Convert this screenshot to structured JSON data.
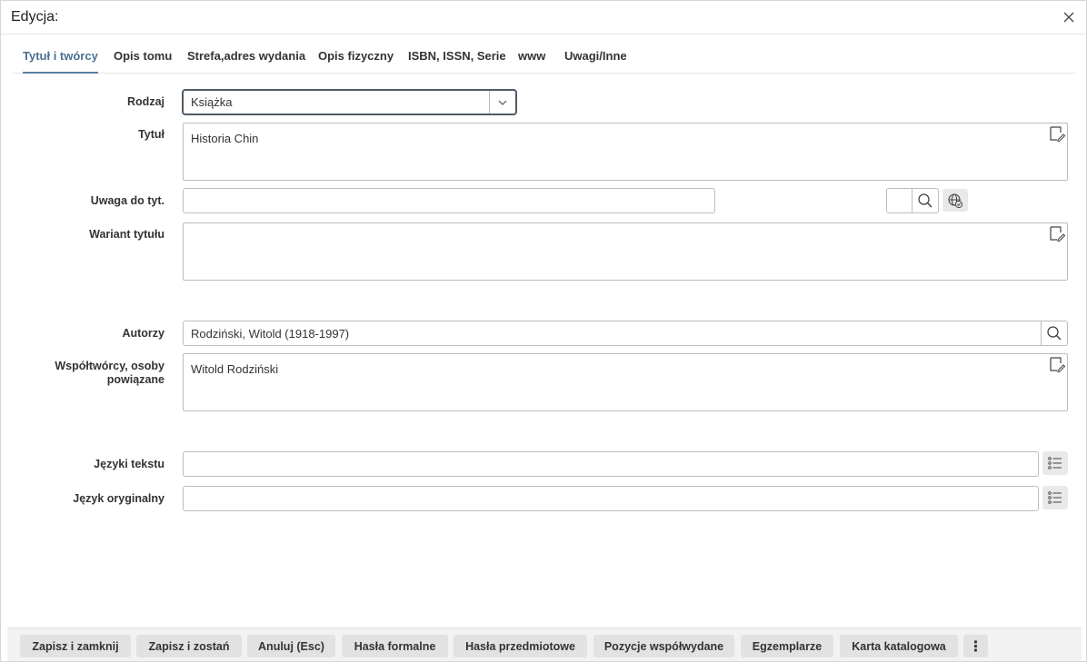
{
  "dialog": {
    "title": "Edycja:"
  },
  "tabs": [
    {
      "label": "Tytuł i twórcy",
      "active": true
    },
    {
      "label": "Opis tomu"
    },
    {
      "label": "Strefa,adres wydania"
    },
    {
      "label": "Opis fizyczny"
    },
    {
      "label": "ISBN, ISSN, Serie"
    },
    {
      "label": "www"
    },
    {
      "label": "Uwagi/Inne"
    }
  ],
  "form": {
    "rodzaj": {
      "label": "Rodzaj",
      "value": "Książka"
    },
    "tytul": {
      "label": "Tytuł",
      "value": "Historia Chin"
    },
    "uwaga": {
      "label": "Uwaga do tyt.",
      "value": "",
      "side_value": ""
    },
    "wariant": {
      "label": "Wariant tytułu",
      "value": ""
    },
    "autorzy": {
      "label": "Autorzy",
      "value": "Rodziński, Witold (1918-1997)"
    },
    "wspoltworcy": {
      "label_line1": "Współtwórcy, osoby",
      "label_line2": "powiązane",
      "value": "Witold Rodziński"
    },
    "jezyki": {
      "label": "Języki tekstu",
      "value": ""
    },
    "jezyk_oryg": {
      "label": "Język oryginalny",
      "value": ""
    }
  },
  "footer": {
    "buttons": [
      "Zapisz i zamknij",
      "Zapisz i zostań",
      "Anuluj (Esc)",
      "Hasła formalne",
      "Hasła przedmiotowe",
      "Pozycje współwydane",
      "Egzemplarze",
      "Karta katalogowa"
    ],
    "more": "⋮"
  }
}
